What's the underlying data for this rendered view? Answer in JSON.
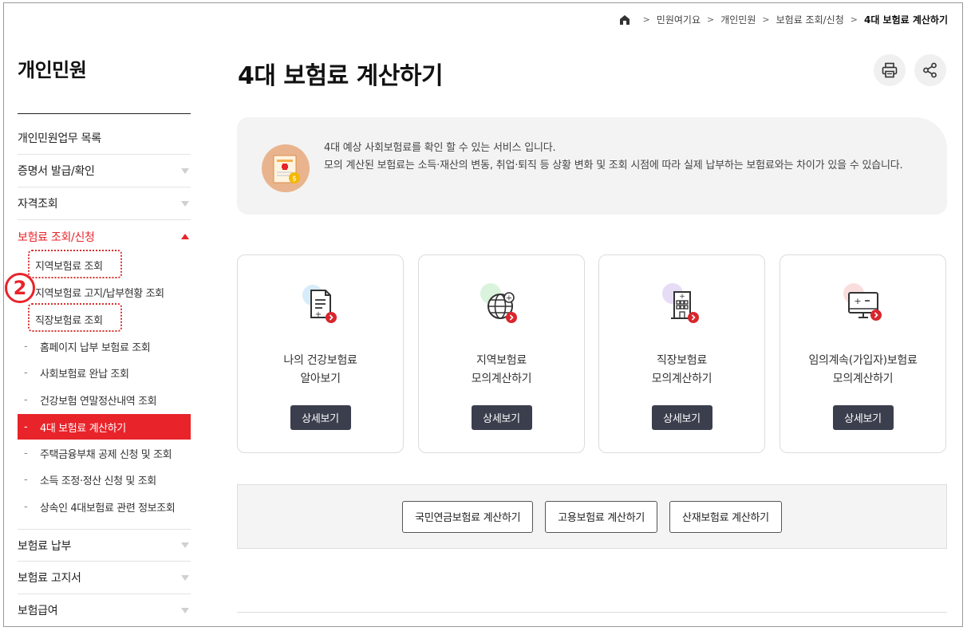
{
  "breadcrumb": {
    "items": [
      "민원여기요",
      "개인민원",
      "보험료 조회/신청",
      "4대 보험료 계산하기"
    ]
  },
  "sidebar": {
    "title": "개인민원",
    "menu": [
      {
        "label": "개인민원업무 목록"
      },
      {
        "label": "증명서 발급/확인"
      },
      {
        "label": "자격조회"
      },
      {
        "label": "보험료 조회/신청"
      }
    ],
    "sub_items": [
      {
        "label": "지역보험료 조회"
      },
      {
        "label": "지역보험료 고지/납부현황 조회"
      },
      {
        "label": "직장보험료 조회"
      },
      {
        "label": "홈페이지 납부 보험료 조회"
      },
      {
        "label": "사회보험료 완납 조회"
      },
      {
        "label": "건강보험 연말정산내역 조회"
      },
      {
        "label": "4대 보험료 계산하기"
      },
      {
        "label": "주택금융부채 공제 신청 및 조회"
      },
      {
        "label": "소득 조정·정산 신청 및 조회"
      },
      {
        "label": "상속인 4대보험료 관련 정보조회"
      }
    ],
    "menu_bottom": [
      {
        "label": "보험료 납부"
      },
      {
        "label": "보험료 고지서"
      },
      {
        "label": "보험급여"
      }
    ],
    "step_badge": "2"
  },
  "main": {
    "title": "4대 보험료 계산하기",
    "notice": {
      "line1": "4대 예상 사회보험료를 확인 할 수 있는 서비스 입니다.",
      "line2": "모의 계산된 보험료는 소득·재산의 변동, 취업·퇴직 등 상황 변화 및 조회 시점에 따라 실제 납부하는 보험료와는 차이가 있을 수 있습니다."
    },
    "cards": [
      {
        "line1": "나의 건강보험료",
        "line2": "알아보기",
        "button": "상세보기",
        "icon": "document-calc-icon",
        "accent": "#d6ecf8"
      },
      {
        "line1": "지역보험료",
        "line2": "모의계산하기",
        "button": "상세보기",
        "icon": "globe-icon",
        "accent": "#daf3dd"
      },
      {
        "line1": "직장보험료",
        "line2": "모의계산하기",
        "button": "상세보기",
        "icon": "building-icon",
        "accent": "#e6dcf6"
      },
      {
        "line1": "임의계속(가입자)보험료",
        "line2": "모의계산하기",
        "button": "상세보기",
        "icon": "monitor-calc-icon",
        "accent": "#fadede"
      }
    ],
    "calc_buttons": [
      "국민연금보험료 계산하기",
      "고용보험료 계산하기",
      "산재보험료 계산하기"
    ]
  },
  "colors": {
    "accent_red": "#e8232a",
    "button_dark": "#3b3e4d"
  }
}
